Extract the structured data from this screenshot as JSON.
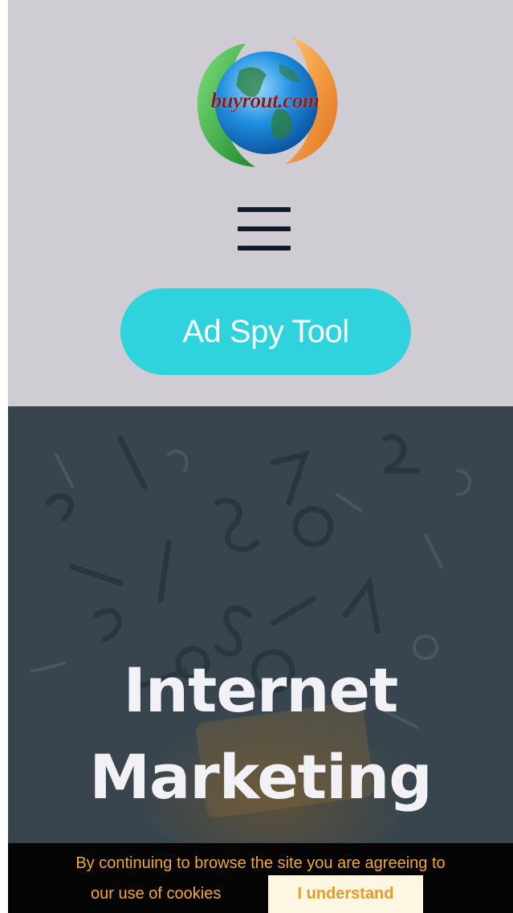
{
  "header": {
    "logo_text": "buyrout.com",
    "menu_icon": "hamburger-menu-icon",
    "cta_label": "Ad Spy Tool"
  },
  "hero": {
    "title_line1": "Internet",
    "title_line2": "Marketing"
  },
  "cookie_notice": {
    "text_line1": "By continuing to browse the site you are agreeing to",
    "text_line2": "our use of cookies",
    "button_label": "I understand"
  },
  "colors": {
    "header_bg": "#cfccd4",
    "cta_bg": "#2ed3dd",
    "cookie_bg": "#050505",
    "cookie_text": "#f0a63a",
    "logo_text": "#8b1a1a"
  }
}
